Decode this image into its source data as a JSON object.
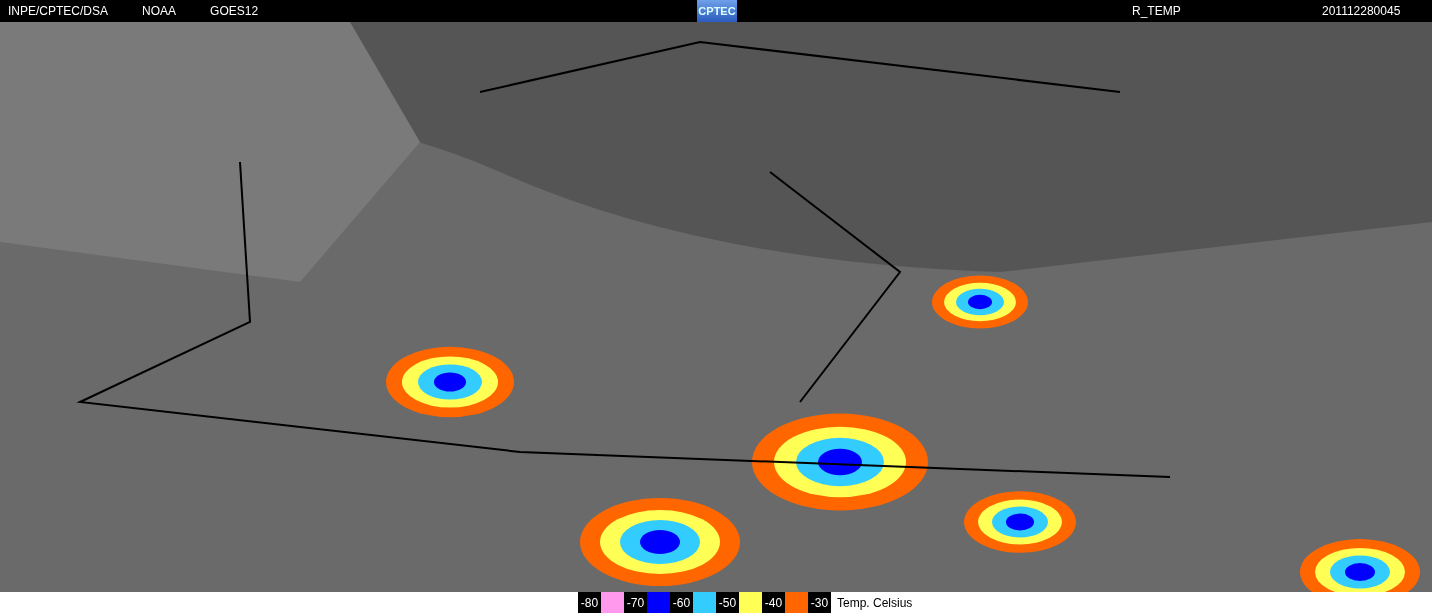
{
  "header": {
    "left": [
      "INPE/CPTEC/DSA",
      "NOAA",
      "GOES12"
    ],
    "logo": "CPTEC",
    "product": "R_TEMP",
    "timestamp": "201112280045"
  },
  "legend": {
    "items": [
      {
        "label": "-80",
        "color": "#ff99ee"
      },
      {
        "label": "-70",
        "color": "#0000ff"
      },
      {
        "label": "-60",
        "color": "#33ccff"
      },
      {
        "label": "-50",
        "color": "#ffff55"
      },
      {
        "label": "-40",
        "color": "#ff6600"
      }
    ],
    "last_label": "-30",
    "unit": "Temp. Celsius"
  }
}
